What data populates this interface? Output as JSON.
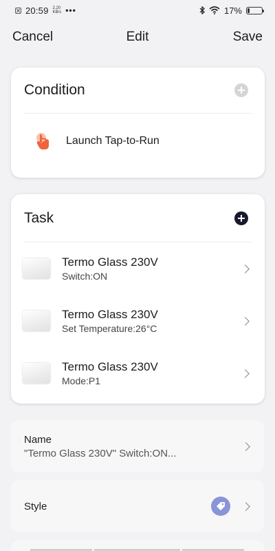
{
  "status_bar": {
    "time": "20:59",
    "speed_value": "2.20",
    "speed_unit": "KB/s",
    "dots": "•••",
    "battery": "17%",
    "battery_level": 0.17
  },
  "header": {
    "cancel": "Cancel",
    "title": "Edit",
    "save": "Save"
  },
  "condition": {
    "title": "Condition",
    "item_label": "Launch Tap-to-Run",
    "icon": "tap-hand-icon",
    "icon_color": "#f0643c"
  },
  "task": {
    "title": "Task",
    "items": [
      {
        "name": "Termo Glass 230V",
        "detail": "Switch:ON"
      },
      {
        "name": "Termo Glass 230V",
        "detail": "Set Temperature:26°C"
      },
      {
        "name": "Termo Glass 230V",
        "detail": "Mode:P1"
      }
    ]
  },
  "name_section": {
    "label": "Name",
    "value": "\"Termo Glass 230V\" Switch:ON..."
  },
  "style_section": {
    "label": "Style",
    "icon": "tag-icon",
    "badge_color": "#8a95d8"
  }
}
